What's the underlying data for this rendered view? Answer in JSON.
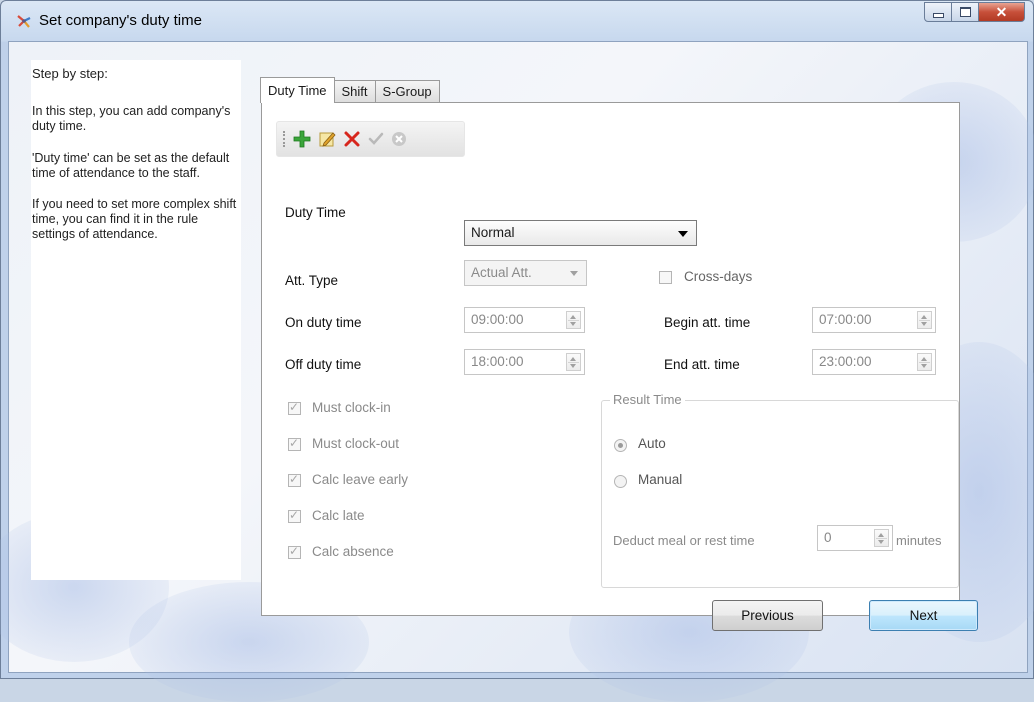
{
  "window": {
    "title": "Set company's duty time",
    "icon": "app-icon"
  },
  "left_panel": {
    "heading": "Step by step:",
    "paragraph1": "In this step, you can add company's duty time.",
    "paragraph2": "'Duty time' can be set as the default time of attendance to the staff.",
    "paragraph3": "If you need to set more complex shift time, you can find it in the rule settings of attendance."
  },
  "tabs": [
    {
      "label": "Duty Time",
      "active": true
    },
    {
      "label": "Shift",
      "active": false
    },
    {
      "label": "S-Group",
      "active": false
    }
  ],
  "toolbar": {
    "buttons": [
      "add-icon",
      "edit-icon",
      "delete-icon",
      "confirm-icon",
      "cancel-icon"
    ]
  },
  "form": {
    "duty_time": {
      "label": "Duty Time",
      "value": "Normal"
    },
    "att_type": {
      "label": "Att. Type",
      "value": "Actual Att."
    },
    "cross_days": {
      "label": "Cross-days",
      "checked": false
    },
    "on_duty": {
      "label": "On duty time",
      "value": "09:00:00"
    },
    "off_duty": {
      "label": "Off duty time",
      "value": "18:00:00"
    },
    "begin_att": {
      "label": "Begin att. time",
      "value": "07:00:00"
    },
    "end_att": {
      "label": "End att. time",
      "value": "23:00:00"
    },
    "checkboxes": [
      {
        "label": "Must clock-in",
        "checked": true
      },
      {
        "label": "Must clock-out",
        "checked": true
      },
      {
        "label": "Calc leave early",
        "checked": true
      },
      {
        "label": "Calc late",
        "checked": true
      },
      {
        "label": "Calc absence",
        "checked": true
      }
    ],
    "result_time": {
      "title": "Result Time",
      "auto_label": "Auto",
      "manual_label": "Manual",
      "selected": "Auto",
      "deduct_label": "Deduct meal or rest time",
      "deduct_value": "0",
      "deduct_unit": "minutes"
    }
  },
  "buttons": {
    "previous": "Previous",
    "next": "Next"
  }
}
